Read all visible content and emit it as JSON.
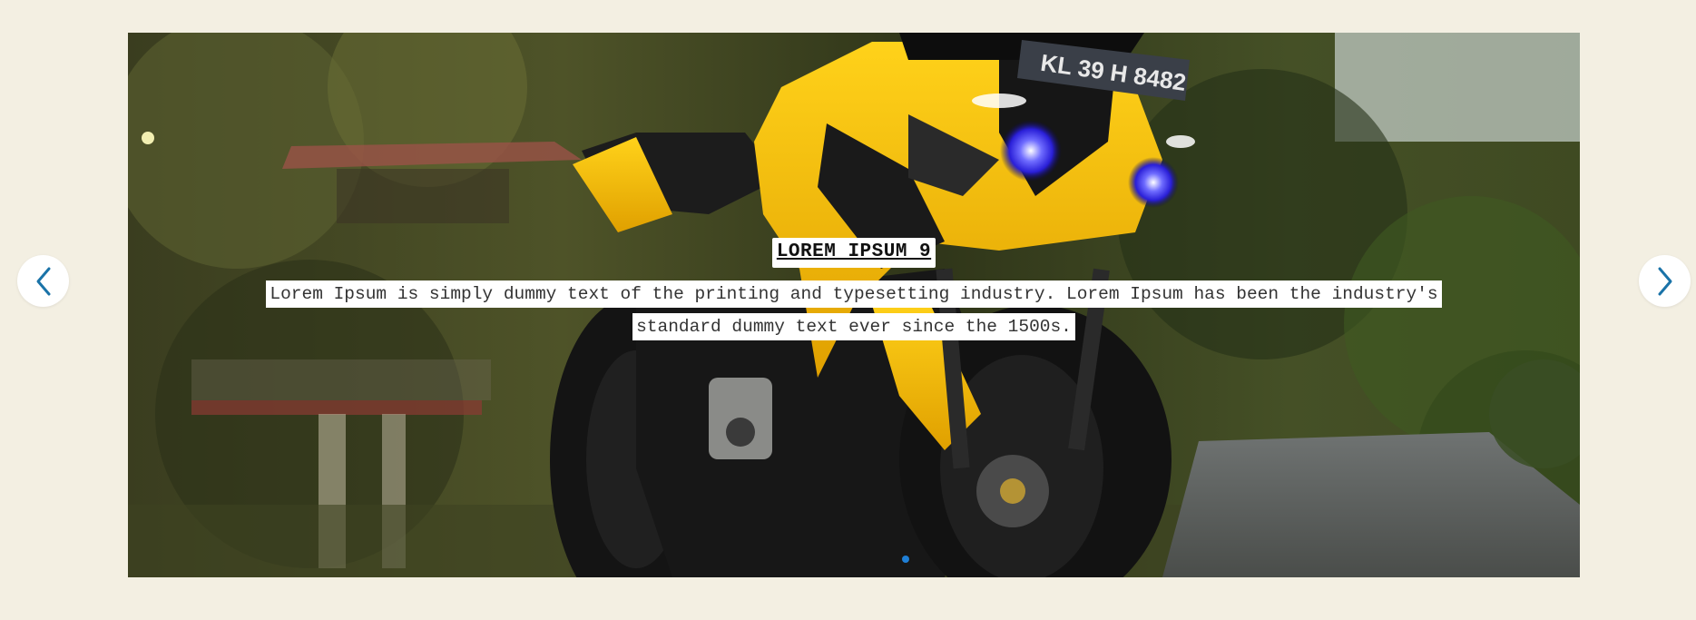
{
  "slider": {
    "slide": {
      "title": "LOREM IPSUM 9",
      "description": "Lorem Ipsum is simply dummy text of the printing and typesetting industry. Lorem Ipsum has been the industry's standard dummy text ever since the 1500s.",
      "image": "yellow-sport-motorcycle-photo",
      "plate": "KL 39 H 8482"
    },
    "prev_icon": "chevron-left-icon",
    "next_icon": "chevron-right-icon",
    "pagination_dots": 1,
    "active_dot": 1
  },
  "colors": {
    "page_background": "#f3efe2",
    "arrow_color": "#1a73a8",
    "active_dot": "#1f7fd6",
    "caption_background": "#ffffff",
    "motorcycle_yellow": "#f2b705"
  }
}
